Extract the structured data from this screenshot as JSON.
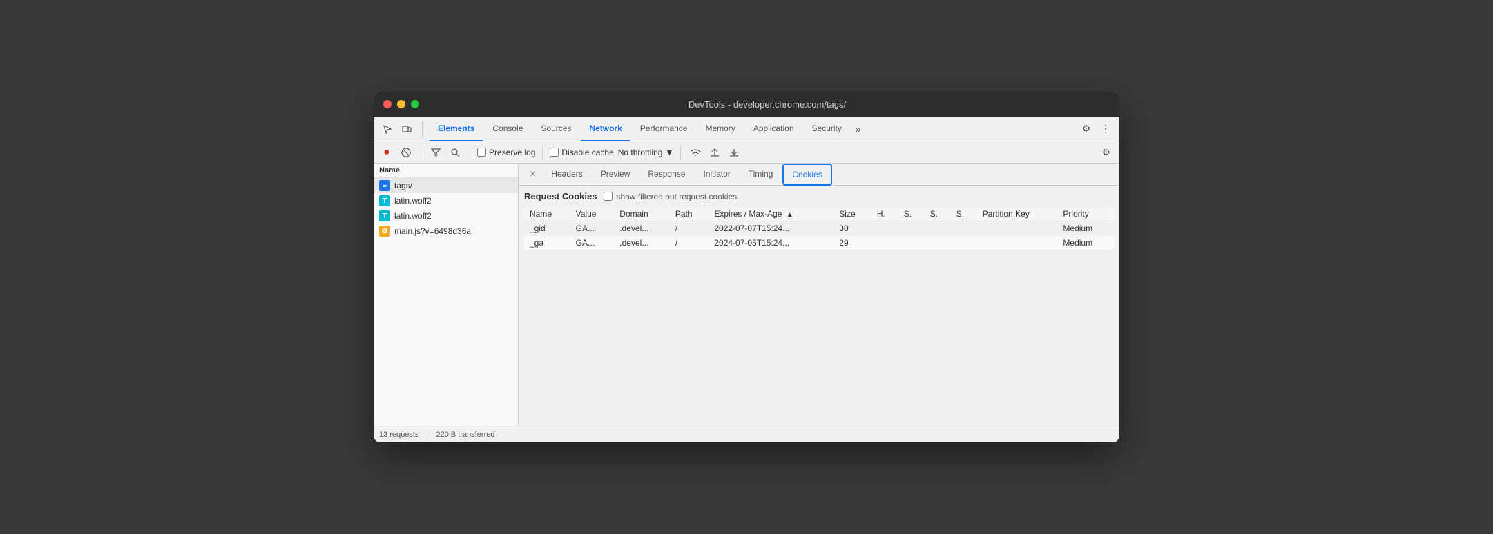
{
  "window": {
    "title": "DevTools - developer.chrome.com/tags/"
  },
  "tabs": {
    "items": [
      {
        "label": "Elements",
        "active": false
      },
      {
        "label": "Console",
        "active": false
      },
      {
        "label": "Sources",
        "active": false
      },
      {
        "label": "Network",
        "active": true
      },
      {
        "label": "Performance",
        "active": false
      },
      {
        "label": "Memory",
        "active": false
      },
      {
        "label": "Application",
        "active": false
      },
      {
        "label": "Security",
        "active": false
      }
    ],
    "more_label": "»"
  },
  "toolbar": {
    "preserve_log": "Preserve log",
    "disable_cache": "Disable cache",
    "throttle": "No throttling"
  },
  "sidebar": {
    "header": "Name",
    "items": [
      {
        "name": "tags/",
        "icon_type": "blue",
        "icon_label": "≡",
        "selected": true
      },
      {
        "name": "latin.woff2",
        "icon_type": "cyan",
        "icon_label": "T",
        "selected": false
      },
      {
        "name": "latin.woff2",
        "icon_type": "cyan",
        "icon_label": "T",
        "selected": false
      },
      {
        "name": "main.js?v=6498d36a",
        "icon_type": "yellow",
        "icon_label": "⚙",
        "selected": false
      }
    ]
  },
  "detail_tabs": {
    "items": [
      {
        "label": "Headers",
        "active": false
      },
      {
        "label": "Preview",
        "active": false
      },
      {
        "label": "Response",
        "active": false
      },
      {
        "label": "Initiator",
        "active": false
      },
      {
        "label": "Timing",
        "active": false
      },
      {
        "label": "Cookies",
        "active": true
      }
    ]
  },
  "cookies": {
    "section_title": "Request Cookies",
    "show_filtered_label": "show filtered out request cookies",
    "columns": [
      {
        "label": "Name",
        "key": "name"
      },
      {
        "label": "Value",
        "key": "value"
      },
      {
        "label": "Domain",
        "key": "domain"
      },
      {
        "label": "Path",
        "key": "path"
      },
      {
        "label": "Expires / Max-Age",
        "key": "expires",
        "sort": "asc"
      },
      {
        "label": "Size",
        "key": "size"
      },
      {
        "label": "H.",
        "key": "h"
      },
      {
        "label": "S.",
        "key": "s1"
      },
      {
        "label": "S.",
        "key": "s2"
      },
      {
        "label": "S.",
        "key": "s3"
      },
      {
        "label": "Partition Key",
        "key": "partition_key"
      },
      {
        "label": "Priority",
        "key": "priority"
      }
    ],
    "rows": [
      {
        "name": "_gid",
        "value": "GA...",
        "domain": ".devel...",
        "path": "/",
        "expires": "2022-07-07T15:24...",
        "size": "30",
        "h": "",
        "s1": "",
        "s2": "",
        "s3": "",
        "partition_key": "",
        "priority": "Medium"
      },
      {
        "name": "_ga",
        "value": "GA...",
        "domain": ".devel...",
        "path": "/",
        "expires": "2024-07-05T15:24...",
        "size": "29",
        "h": "",
        "s1": "",
        "s2": "",
        "s3": "",
        "partition_key": "",
        "priority": "Medium"
      }
    ]
  },
  "status_bar": {
    "requests": "13 requests",
    "transferred": "220 B transferred"
  }
}
